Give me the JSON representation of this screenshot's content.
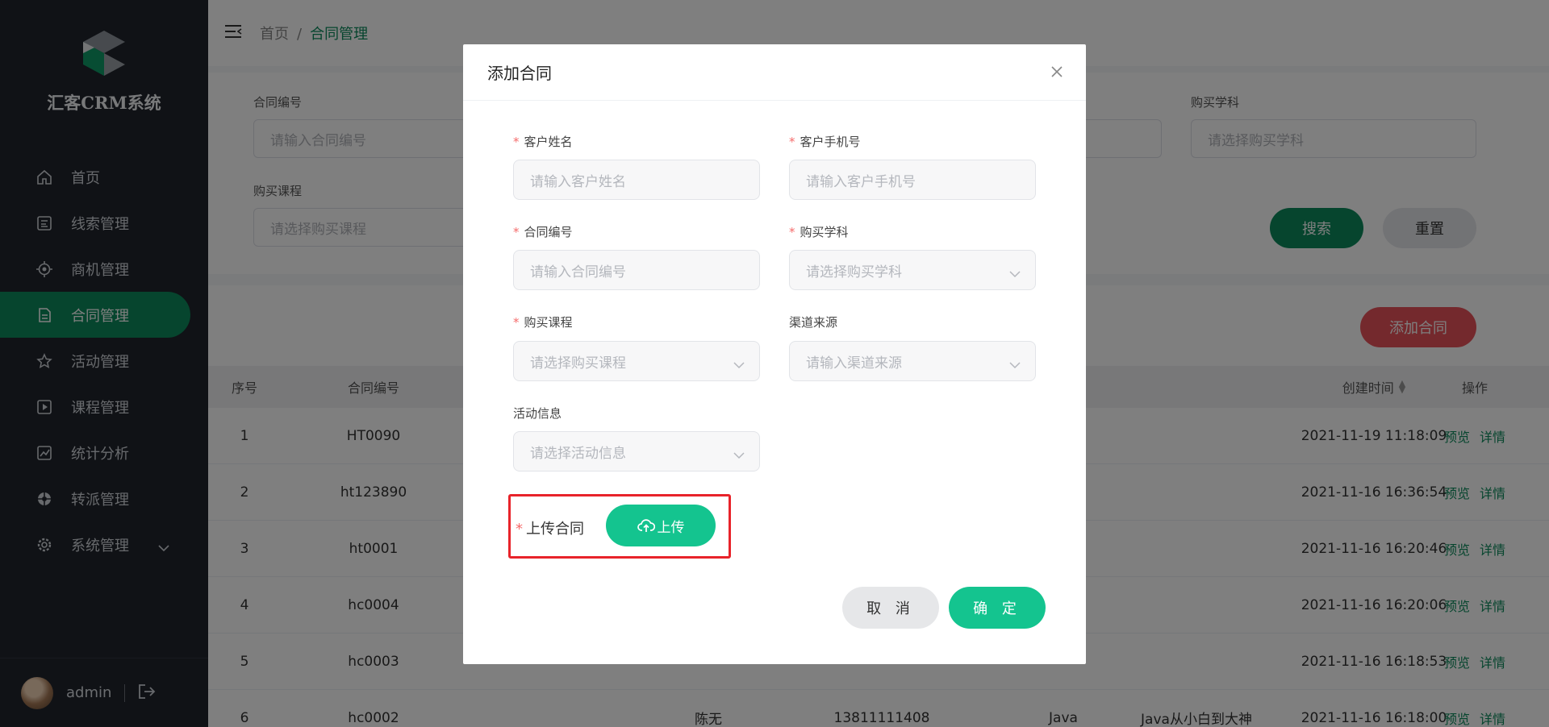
{
  "app": {
    "name": "汇客CRM系统"
  },
  "sidebar": {
    "items": [
      {
        "label": "首页",
        "icon": "home-icon"
      },
      {
        "label": "线索管理",
        "icon": "clue-icon"
      },
      {
        "label": "商机管理",
        "icon": "target-icon"
      },
      {
        "label": "合同管理",
        "icon": "document-icon",
        "active": true
      },
      {
        "label": "活动管理",
        "icon": "star-icon"
      },
      {
        "label": "课程管理",
        "icon": "video-icon"
      },
      {
        "label": "统计分析",
        "icon": "chart-icon"
      },
      {
        "label": "转派管理",
        "icon": "transfer-icon"
      },
      {
        "label": "系统管理",
        "icon": "gear-icon"
      }
    ],
    "user": {
      "name": "admin"
    }
  },
  "breadcrumb": {
    "home": "首页",
    "sep": "/",
    "current": "合同管理"
  },
  "filter": {
    "contract_no_label": "合同编号",
    "contract_no_placeholder": "请输入合同编号",
    "subject_label": "购买学科",
    "subject_placeholder": "请选择购买学科",
    "course_label": "购买课程",
    "course_placeholder": "请选择购买课程",
    "search": "搜索",
    "reset": "重置"
  },
  "toolbar": {
    "add": "添加合同"
  },
  "table": {
    "headers": {
      "index": "序号",
      "contract_no": "合同编号",
      "created": "创建时间",
      "actions": "操作"
    },
    "preview": "预览",
    "detail": "详情",
    "rows": [
      {
        "index": "1",
        "contract_no": "HT0090",
        "created": "2021-11-19 11:18:09"
      },
      {
        "index": "2",
        "contract_no": "ht123890",
        "created": "2021-11-16 16:36:54"
      },
      {
        "index": "3",
        "contract_no": "ht0001",
        "created": "2021-11-16 16:20:46"
      },
      {
        "index": "4",
        "contract_no": "hc0004",
        "created": "2021-11-16 16:20:06"
      },
      {
        "index": "5",
        "contract_no": "hc0003",
        "created": "2021-11-16 16:18:53"
      },
      {
        "index": "6",
        "contract_no": "hc0002",
        "name": "陈无",
        "phone": "13811111408",
        "subject": "Java",
        "course": "Java从小白到大神",
        "created": "2021-11-16 16:18:00"
      }
    ]
  },
  "modal": {
    "title": "添加合同",
    "customer_name_label": "客户姓名",
    "customer_name_placeholder": "请输入客户姓名",
    "customer_phone_label": "客户手机号",
    "customer_phone_placeholder": "请输入客户手机号",
    "contract_no_label": "合同编号",
    "contract_no_placeholder": "请输入合同编号",
    "subject_label": "购买学科",
    "subject_placeholder": "请选择购买学科",
    "course_label": "购买课程",
    "course_placeholder": "请选择购买课程",
    "channel_label": "渠道来源",
    "channel_placeholder": "请输入渠道来源",
    "activity_label": "活动信息",
    "activity_placeholder": "请选择活动信息",
    "upload_label": "上传合同",
    "upload_button": "上传",
    "required_mark": "*",
    "cancel": "取 消",
    "confirm": "确 定"
  },
  "colors": {
    "brand": "#0c8a5c",
    "upload": "#14c48f",
    "danger": "#e8232a",
    "sidebar": "#20242c"
  }
}
